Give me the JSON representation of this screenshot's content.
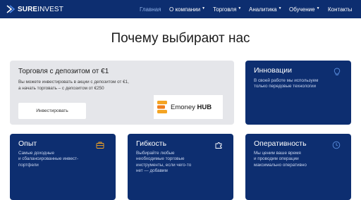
{
  "nav": {
    "logo_bold": "SURE",
    "logo_rest": "INVEST",
    "items": [
      {
        "label": "Главная",
        "caret": ""
      },
      {
        "label": "О компании",
        "caret": "▼"
      },
      {
        "label": "Торговля",
        "caret": "▼"
      },
      {
        "label": "Аналитика",
        "caret": "▼"
      },
      {
        "label": "Обучение",
        "caret": "▼"
      },
      {
        "label": "Контакты",
        "caret": ""
      }
    ]
  },
  "heading": "Почему выбирают нас",
  "promo": {
    "title": "Торговля с депозитом от €1",
    "text_line1": "Вы можете инвестировать в акции с депозитом от €1,",
    "text_line2": "а начать торговать – с депозитом от €250",
    "button": "Инвестировать",
    "hub_name": "Emoney",
    "hub_bold": "HUB"
  },
  "cards": [
    {
      "title": "Инновации",
      "lines": [
        "В своей работе мы используем",
        "только передовые технологии"
      ],
      "icon": "lightbulb-icon"
    },
    {
      "title": "Опыт",
      "lines": [
        "Самые доходные",
        "и сбалансированные инвест-",
        "портфели"
      ],
      "icon": "briefcase-icon"
    },
    {
      "title": "Гибкость",
      "lines": [
        "Выбирайте любые",
        "необходимые торговые",
        "инструменты, если чего-то",
        "нет — добавим"
      ],
      "icon": "puzzle-icon"
    },
    {
      "title": "Оперативность",
      "lines": [
        "Мы ценим ваше время",
        "и проводим операции",
        "максимально оперативно"
      ],
      "icon": "clock-icon"
    }
  ],
  "colors": {
    "nav": "#0d2e70",
    "card": "#0d2e70",
    "promo_bg": "#e5e6ea",
    "accent": "#f4a423"
  }
}
